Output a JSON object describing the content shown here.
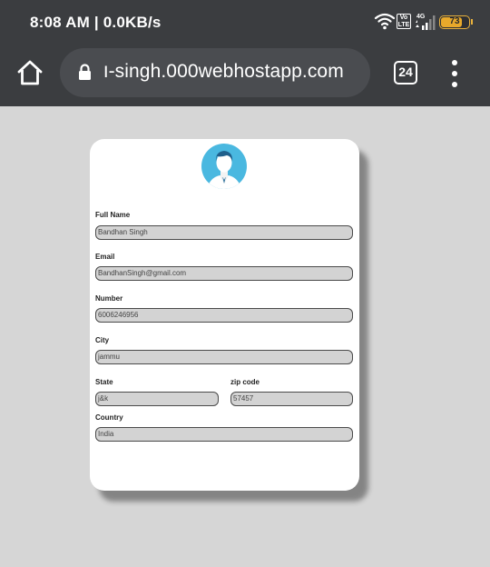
{
  "status_bar": {
    "time": "8:08 AM | 0.0KB/s",
    "volte_label": "Vo LTE",
    "network_type": "4G",
    "battery_level": "73",
    "icons": [
      "wifi-icon",
      "volte-icon",
      "signal-icon",
      "battery-icon"
    ]
  },
  "browser": {
    "url": "ו-singh.000webhostapp.com",
    "tab_count": "24",
    "icons": [
      "home-icon",
      "lock-icon",
      "tabs-icon",
      "overflow-menu-icon"
    ]
  },
  "form": {
    "avatar_icon": "user-avatar-icon",
    "fields": {
      "full_name": {
        "label": "Full Name",
        "value": "Bandhan Singh"
      },
      "email": {
        "label": "Email",
        "value": "BandhanSingh@gmail.com"
      },
      "number": {
        "label": "Number",
        "value": "6006246956"
      },
      "city": {
        "label": "City",
        "value": "jammu"
      },
      "state": {
        "label": "State",
        "value": "j&k"
      },
      "zip_code": {
        "label": "zip code",
        "value": "57457"
      },
      "country": {
        "label": "Country",
        "value": "India"
      }
    }
  },
  "colors": {
    "chrome_bg": "#3b3d40",
    "url_bar_bg": "#4a4c50",
    "page_bg": "#d6d6d6",
    "input_bg": "#d3d3d3",
    "battery": "#e8a92b",
    "avatar_blue": "#4ab8e0"
  }
}
